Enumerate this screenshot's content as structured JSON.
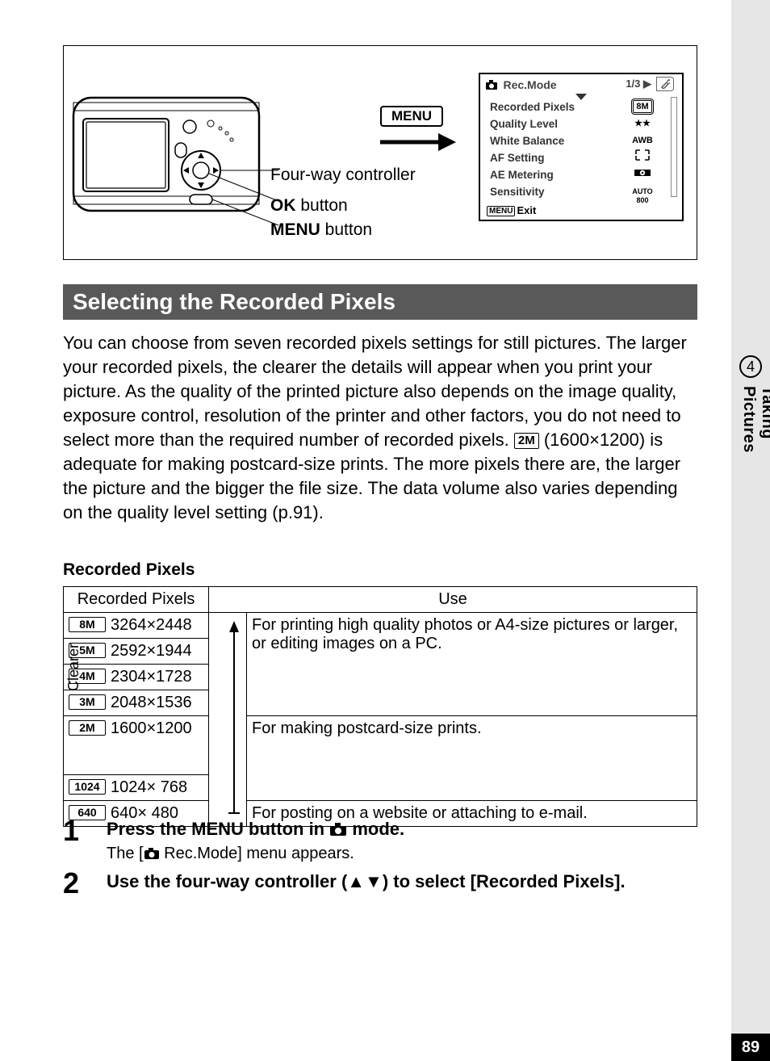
{
  "sideTab": {
    "chapterNum": "4",
    "chapterLabel": "Taking Pictures"
  },
  "pageNumber": "89",
  "figure": {
    "menuBox": "MENU",
    "callouts": {
      "fourWay": "Four-way controller",
      "okBold": "OK",
      "okRest": " button",
      "menuBold": "MENU",
      "menuRest": " button"
    },
    "lcd": {
      "title": "Rec.Mode",
      "page": "1/3",
      "items": [
        "Recorded Pixels",
        "Quality Level",
        "White Balance",
        "AF Setting",
        "AE Metering",
        "Sensitivity"
      ],
      "vals": {
        "recordedPixels": "8M",
        "quality": "★★",
        "wb": "AWB",
        "sensitivity": "AUTO 800"
      },
      "footer": {
        "menu": "MENU",
        "exit": "Exit"
      }
    }
  },
  "sectionHeading": "Selecting the Recorded Pixels",
  "paragraph": {
    "p1": "You can choose from seven recorded pixels settings for still pictures. The larger your recorded pixels, the clearer the details will appear when you print your picture. As the quality of the printed picture also depends on the image quality, exposure control, resolution of the printer and other factors, you do not need to select more than the required number of recorded pixels. ",
    "pxLabel": "2M",
    "p2": " (1600×1200) is adequate for making postcard-size prints. The more pixels there are, the larger the picture and the bigger the file size. The data volume also varies depending on the quality level setting (p.91)."
  },
  "subheading": "Recorded Pixels",
  "table": {
    "head": {
      "c1": "Recorded Pixels",
      "c2": "Use"
    },
    "clearer": "Clearer",
    "rows": [
      {
        "label": "8M",
        "res": "3264×2448"
      },
      {
        "label": "5M",
        "res": "2592×1944"
      },
      {
        "label": "4M",
        "res": "2304×1728"
      },
      {
        "label": "3M",
        "res": "2048×1536"
      },
      {
        "label": "2M",
        "res": "1600×1200"
      },
      {
        "label": "1024",
        "res": "1024× 768"
      },
      {
        "label": "640",
        "res": "640× 480"
      }
    ],
    "uses": {
      "top": "For printing high quality photos or A4-size pictures or larger, or editing images on a PC.",
      "mid": "For making postcard-size prints.",
      "bot": "For posting on a website or attaching to e-mail."
    }
  },
  "steps": {
    "s1": {
      "num": "1",
      "titleA": "Press the MENU button in ",
      "titleB": " mode.",
      "desc": "The [",
      "desc2": " Rec.Mode] menu appears."
    },
    "s2": {
      "num": "2",
      "title": "Use the four-way controller (▲▼) to select [Recorded Pixels]."
    }
  }
}
